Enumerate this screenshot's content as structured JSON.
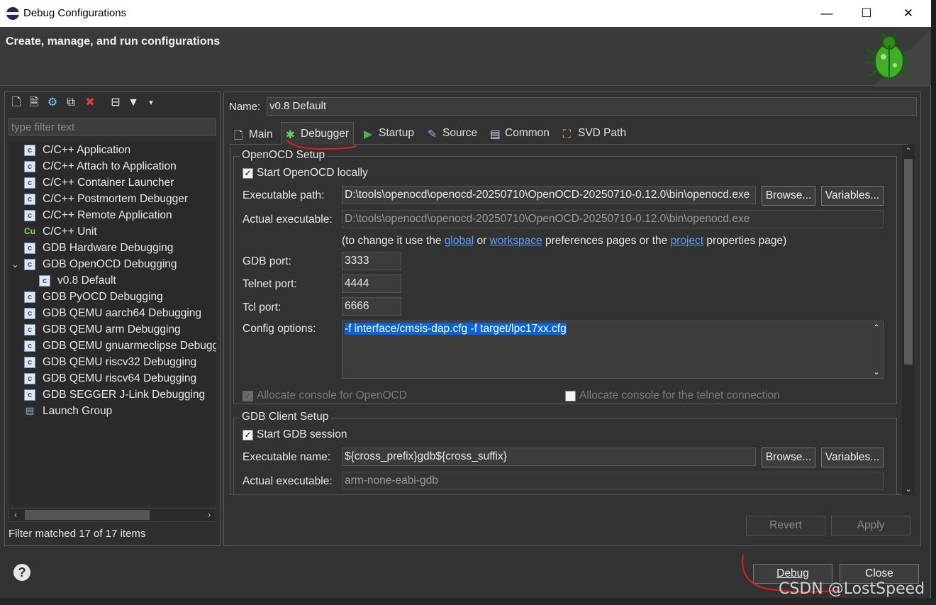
{
  "window": {
    "title": "Debug Configurations",
    "minimize": "—",
    "maximize": "☐",
    "close": "✕"
  },
  "banner": {
    "title": "Create, manage, and run configurations"
  },
  "left": {
    "filter_placeholder": "type filter text",
    "tree": [
      {
        "label": "C/C++ Application"
      },
      {
        "label": "C/C++ Attach to Application"
      },
      {
        "label": "C/C++ Container Launcher"
      },
      {
        "label": "C/C++ Postmortem Debugger"
      },
      {
        "label": "C/C++ Remote Application"
      },
      {
        "label": "C/C++ Unit"
      },
      {
        "label": "GDB Hardware Debugging"
      },
      {
        "label": "GDB OpenOCD Debugging",
        "expanded": true
      },
      {
        "label": "v0.8 Default",
        "child": true
      },
      {
        "label": "GDB PyOCD Debugging"
      },
      {
        "label": "GDB QEMU aarch64 Debugging"
      },
      {
        "label": "GDB QEMU arm Debugging"
      },
      {
        "label": "GDB QEMU gnuarmeclipse Debugging"
      },
      {
        "label": "GDB QEMU riscv32 Debugging"
      },
      {
        "label": "GDB QEMU riscv64 Debugging"
      },
      {
        "label": "GDB SEGGER J-Link Debugging"
      },
      {
        "label": "Launch Group"
      }
    ],
    "status": "Filter matched 17 of 17 items"
  },
  "right": {
    "name_label": "Name:",
    "name_value": "v0.8 Default",
    "tabs": [
      "Main",
      "Debugger",
      "Startup",
      "Source",
      "Common",
      "SVD Path"
    ],
    "active_tab": "Debugger",
    "openocd": {
      "group": "OpenOCD Setup",
      "start_locally": "Start OpenOCD locally",
      "exe_label": "Executable path:",
      "exe_value": "D:\\tools\\openocd\\openocd-20250710\\OpenOCD-20250710-0.12.0\\bin\\openocd.exe",
      "actual_label": "Actual executable:",
      "actual_value": "D:\\tools\\openocd\\openocd-20250710\\OpenOCD-20250710-0.12.0\\bin\\openocd.exe",
      "hint_pre": "(to change it use the ",
      "hint_global": "global",
      "hint_or": " or ",
      "hint_workspace": "workspace",
      "hint_mid": " preferences pages or the ",
      "hint_project": "project",
      "hint_post": " properties page)",
      "gdb_port_label": "GDB port:",
      "gdb_port": "3333",
      "telnet_label": "Telnet port:",
      "telnet_port": "4444",
      "tcl_label": "Tcl port:",
      "tcl_port": "6666",
      "config_label": "Config options:",
      "config_value": "-f interface/cmsis-dap.cfg -f target/lpc17xx.cfg",
      "alloc_openocd": "Allocate console for OpenOCD",
      "alloc_telnet": "Allocate console for the telnet connection"
    },
    "gdb": {
      "group": "GDB Client Setup",
      "start_session": "Start GDB session",
      "exe_label": "Executable name:",
      "exe_value": "${cross_prefix}gdb${cross_suffix}",
      "actual_label": "Actual executable:",
      "actual_value": "arm-none-eabi-gdb"
    },
    "browse": "Browse...",
    "variables": "Variables...",
    "revert": "Revert",
    "apply": "Apply"
  },
  "footer": {
    "help": "?",
    "debug": "Debug",
    "close": "Close"
  },
  "watermark": "CSDN @LostSpeed"
}
